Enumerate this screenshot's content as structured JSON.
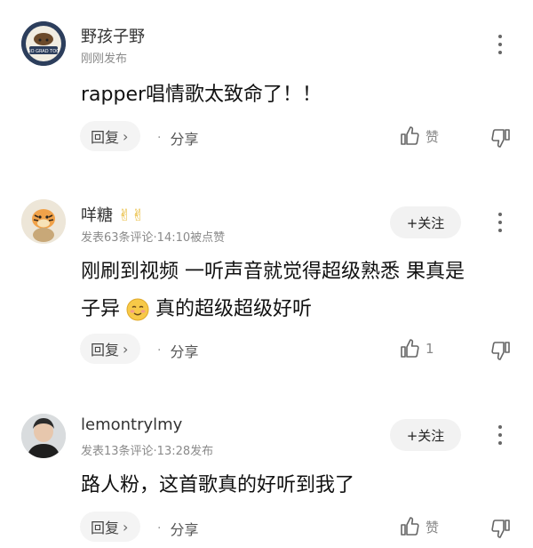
{
  "comments": [
    {
      "username": "野孩子野",
      "meta": "刚刚发布",
      "text_lines": [
        "rapper唱情歌太致命了！！"
      ],
      "reply_label": "回复",
      "share_label": "分享",
      "like_label": "赞",
      "avatar_icon": "avatar-cartoon-badge",
      "avatar_badge_text": "NO GRAD TOO"
    },
    {
      "username": "咩糖",
      "username_emojis": "✌✌",
      "meta": "发表63条评论·14:10被点赞",
      "follow_label": "+关注",
      "text_lines": [
        "刚刷到视频 一听声音就觉得超级熟悉 果真是",
        "子异",
        " 真的超级超级好听"
      ],
      "reply_label": "回复",
      "share_label": "分享",
      "like_count": "1",
      "avatar_icon": "avatar-tigger"
    },
    {
      "username": "lemontrylmy",
      "meta": "发表13条评论·13:28发布",
      "follow_label": "+关注",
      "text_lines": [
        "路人粉，这首歌真的好听到我了"
      ],
      "reply_label": "回复",
      "share_label": "分享",
      "like_label": "赞",
      "avatar_icon": "avatar-photo-person"
    }
  ],
  "icons": {
    "more": "more-vertical-icon",
    "like": "thumb-up-icon",
    "dislike": "thumb-down-icon",
    "reply_chevron": "chevron-right-icon",
    "smile_emoji": "smiling-face-emoji"
  },
  "colors": {
    "text": "#111111",
    "meta": "#8a8a8a",
    "pill": "#f4f4f4"
  }
}
